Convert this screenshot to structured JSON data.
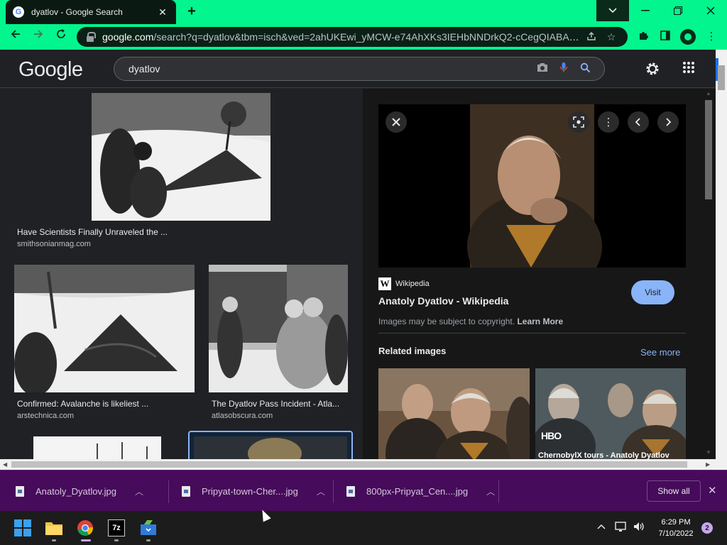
{
  "browser": {
    "tab_title": "dyatlov - Google Search",
    "tab_favicon": "G",
    "new_tab": "+",
    "url_host": "google.com",
    "url_path": "/search?q=dyatlov&tbm=isch&ved=2ahUKEwi_yMCW-e74AhXKs3IEHbNNDrkQ2-cCegQIABAA...",
    "accent_color": "#03f58d"
  },
  "google": {
    "logo": "Google",
    "query": "dyatlov"
  },
  "results": [
    {
      "caption": "Have Scientists Finally Unraveled the ...",
      "source": "smithsonianmag.com"
    },
    {
      "caption": "Confirmed: Avalanche is likeliest ...",
      "source": "arstechnica.com"
    },
    {
      "caption": "The Dyatlov Pass Incident - Atla...",
      "source": "atlasobscura.com"
    }
  ],
  "panel": {
    "source_name": "Wikipedia",
    "source_icon": "W",
    "title": "Anatoly Dyatlov - Wikipedia",
    "visit_label": "Visit",
    "copyright_text": "Images may be subject to copyright.",
    "learn_more": "Learn More",
    "related_heading": "Related images",
    "see_more": "See more",
    "related": [
      {
        "badge": ""
      },
      {
        "badge": "HBO",
        "caption": "ChernobylX tours - Anatoly Dyatlov"
      }
    ]
  },
  "downloads": {
    "items": [
      {
        "name": "Anatoly_Dyatlov.jpg"
      },
      {
        "name": "Pripyat-town-Cher....jpg"
      },
      {
        "name": "800px-Pripyat_Cen....jpg"
      }
    ],
    "show_all": "Show all",
    "bar_color": "#460b5a"
  },
  "taskbar": {
    "time": "6:29 PM",
    "date": "7/10/2022",
    "notification_count": "2",
    "sevenzip_label": "7z"
  }
}
